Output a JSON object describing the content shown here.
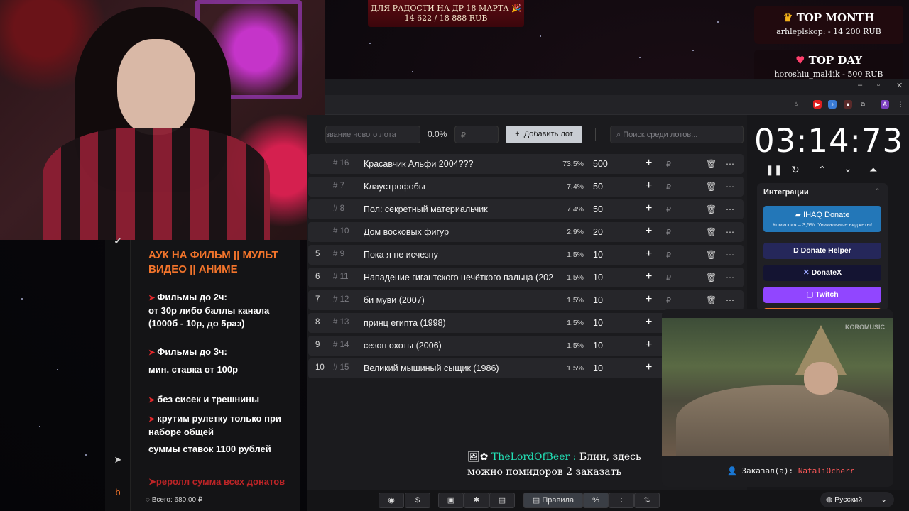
{
  "top_banner": {
    "line1": "ДЛЯ РАДОСТИ НА ДР 18 МАРТА 🎉",
    "line2": "14 622 / 18 888 RUB"
  },
  "top_month": {
    "title": "TOP MONTH",
    "entry": "arhleplskop: - 14 200 RUB"
  },
  "top_day": {
    "title": "TOP DAY",
    "entry": "horoshiu_mal4ik - 500 RUB"
  },
  "rules": {
    "title": "АУК НА ФИЛЬМ || МУЛЬТ ВИДЕО || АНИМЕ",
    "blocks": [
      {
        "head": "Фильмы до 2ч:",
        "body": "от 30р либо баллы канала (1000б - 10р, до 5раз)"
      },
      {
        "head": "Фильмы до 3ч:",
        "body": "мин. ставка от 100р"
      },
      {
        "head": "без сисек и трешнины",
        "body": ""
      },
      {
        "head": "крутим рулетку только при наборе общей",
        "body": "суммы ставок 1100 рублей"
      }
    ],
    "faded": "реролл сумма всех донатов",
    "total_label": "Всего: 680,00 ₽"
  },
  "toolbar": {
    "lot_placeholder": "звание нового лота",
    "percent": "0.0%",
    "rub_placeholder": "₽",
    "add_lot": "Добавить лот",
    "search_placeholder": "Поиск среди лотов..."
  },
  "lots": [
    {
      "place": "",
      "id": "# 16",
      "name": "Красавчик Альфи 2004???",
      "pct": "73.5%",
      "amount": "500"
    },
    {
      "place": "",
      "id": "# 7",
      "name": "Клаустрофобы",
      "pct": "7.4%",
      "amount": "50"
    },
    {
      "place": "",
      "id": "# 8",
      "name": "Пол: секретный материальчик",
      "pct": "7.4%",
      "amount": "50"
    },
    {
      "place": "",
      "id": "# 10",
      "name": "Дом восковых фигур",
      "pct": "2.9%",
      "amount": "20"
    },
    {
      "place": "5",
      "id": "# 9",
      "name": "Пока я не исчезну",
      "pct": "1.5%",
      "amount": "10"
    },
    {
      "place": "6",
      "id": "# 11",
      "name": "Нападение гигантского нечёткого пальца (202",
      "pct": "1.5%",
      "amount": "10"
    },
    {
      "place": "7",
      "id": "# 12",
      "name": "би муви (2007)",
      "pct": "1.5%",
      "amount": "10"
    },
    {
      "place": "8",
      "id": "# 13",
      "name": "принц египта (1998)",
      "pct": "1.5%",
      "amount": "10"
    },
    {
      "place": "9",
      "id": "# 14",
      "name": "сезон охоты (2006)",
      "pct": "1.5%",
      "amount": "10"
    },
    {
      "place": "10",
      "id": "# 15",
      "name": "Великий мышиный сыщик (1986)",
      "pct": "1.5%",
      "amount": "10"
    }
  ],
  "timer": "03:14:73",
  "integrations": {
    "title": "Интеграции",
    "ihaq_title": "IHAQ Donate",
    "ihaq_sub": "Комиссия – 3,5%. Уникальные виджеты!",
    "donate_helper": "Donate Helper",
    "donatex": "DonateX",
    "twitch": "Twitch"
  },
  "video": {
    "watermark": "KOROMUSIC",
    "ordered_label": "Заказал(а):",
    "ordered_name": "NataliOcherr"
  },
  "chat": {
    "user": "TheLordOfBeer",
    "message": "Блин, здесь можно помидоров 2 заказать"
  },
  "bottom": {
    "rules_btn": "Правила",
    "language": "Русский"
  },
  "colors": {
    "accent_orange": "#f2742b",
    "accent_red": "#e6282b",
    "ihaq_blue": "#2377b8",
    "twitch_purple": "#9146ff",
    "donatex_bg": "#141432"
  }
}
